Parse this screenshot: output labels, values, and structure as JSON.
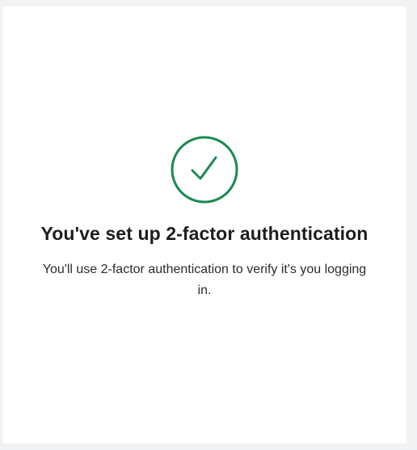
{
  "status": {
    "icon": "checkmark-circle-icon",
    "accent_color": "#1a8a52"
  },
  "title": "You've set up 2-factor authentication",
  "message": "You'll use 2-factor authentication to verify it's you logging in."
}
